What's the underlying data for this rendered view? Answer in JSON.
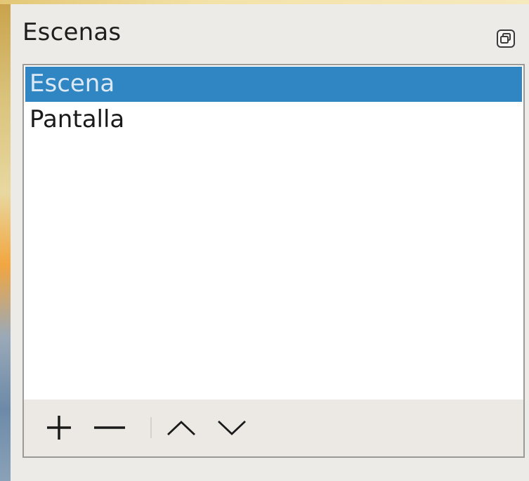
{
  "dock": {
    "title": "Escenas",
    "float_icon": "undock-icon"
  },
  "scenes": {
    "items": [
      {
        "label": "Escena",
        "selected": true
      },
      {
        "label": "Pantalla",
        "selected": false
      }
    ],
    "selected_color": "#2f86c3"
  },
  "toolbar": {
    "buttons": [
      {
        "icon": "plus-icon"
      },
      {
        "icon": "minus-icon"
      },
      {
        "icon": "chevron-up-icon"
      },
      {
        "icon": "chevron-down-icon"
      }
    ]
  }
}
